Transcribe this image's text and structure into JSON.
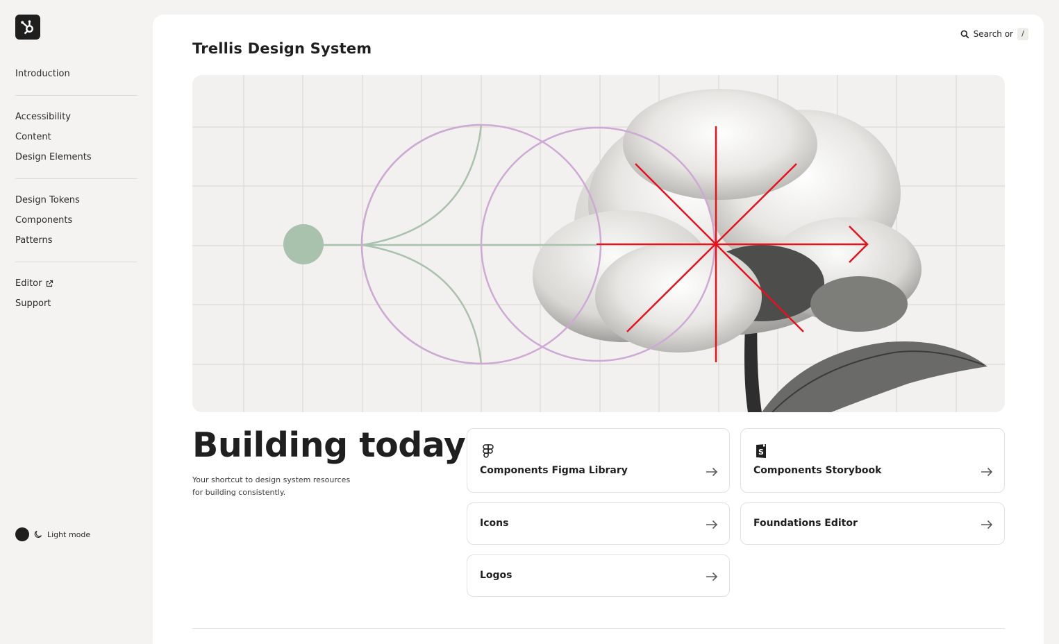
{
  "sidebar": {
    "logo_icon": "hubspot-sprocket-icon",
    "groups": [
      [
        {
          "label": "Introduction"
        }
      ],
      [
        {
          "label": "Accessibility"
        },
        {
          "label": "Content"
        },
        {
          "label": "Design Elements"
        }
      ],
      [
        {
          "label": "Design Tokens"
        },
        {
          "label": "Components"
        },
        {
          "label": "Patterns"
        }
      ],
      [
        {
          "label": "Editor",
          "external": true
        },
        {
          "label": "Support"
        }
      ]
    ],
    "theme_label": "Light mode"
  },
  "header": {
    "search_label": "Search or",
    "search_shortcut": "/"
  },
  "main": {
    "title": "Trellis Design System",
    "headline": "Building today",
    "subtext": "Your shortcut to design system resources for building consistently.",
    "cards": [
      {
        "label": "Components Figma Library",
        "icon": "figma-icon"
      },
      {
        "label": "Components Storybook",
        "icon": "storybook-icon"
      },
      {
        "label": "Icons"
      },
      {
        "label": "Foundations Editor"
      },
      {
        "label": "Logos"
      }
    ]
  },
  "colors": {
    "accent_green": "#a9c2ad",
    "accent_purple": "#cfa8d6",
    "accent_red": "#e5121a",
    "ink": "#1f1f1f"
  }
}
